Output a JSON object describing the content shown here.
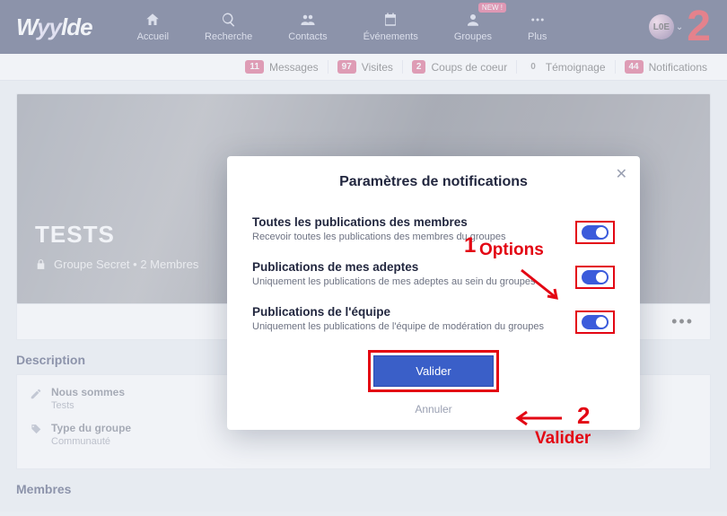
{
  "brand": "Wyylde",
  "nav": {
    "home": "Accueil",
    "search": "Recherche",
    "contacts": "Contacts",
    "events": "Événements",
    "groups": "Groupes",
    "more": "Plus",
    "new_badge": "NEW !"
  },
  "stats": {
    "messages": {
      "count": "11",
      "label": "Messages"
    },
    "visits": {
      "count": "97",
      "label": "Visites"
    },
    "hearts": {
      "count": "2",
      "label": "Coups de coeur"
    },
    "testim": {
      "count": "0",
      "label": "Témoignage"
    },
    "notif": {
      "count": "44",
      "label": "Notifications"
    }
  },
  "hero": {
    "title": "TESTS",
    "subtitle": "Groupe Secret • 2 Membres"
  },
  "sections": {
    "description": "Description",
    "members": "Membres",
    "info": {
      "who_label": "Nous sommes",
      "who_value": "Tests",
      "type_label": "Type du groupe",
      "type_value": "Communauté"
    }
  },
  "modal": {
    "title": "Paramètres de notifications",
    "opt1": {
      "title": "Toutes les publications des membres",
      "desc": "Recevoir toutes les publications des membres du groupes"
    },
    "opt2": {
      "title": "Publications de mes adeptes",
      "desc": "Uniquement les publications de mes adeptes au sein du groupes"
    },
    "opt3": {
      "title": "Publications de l'équipe",
      "desc": "Uniquement les publications de l'équipe de modération du groupes"
    },
    "validate": "Valider",
    "cancel": "Annuler"
  },
  "annotations": {
    "step1_num": "1",
    "step1_label": "Options",
    "step2_num": "2",
    "step2_label": "Valider",
    "big2": "2"
  },
  "colors": {
    "accent": "#e30613",
    "primary": "#3a5fc8",
    "navy": "#1f2a56"
  }
}
